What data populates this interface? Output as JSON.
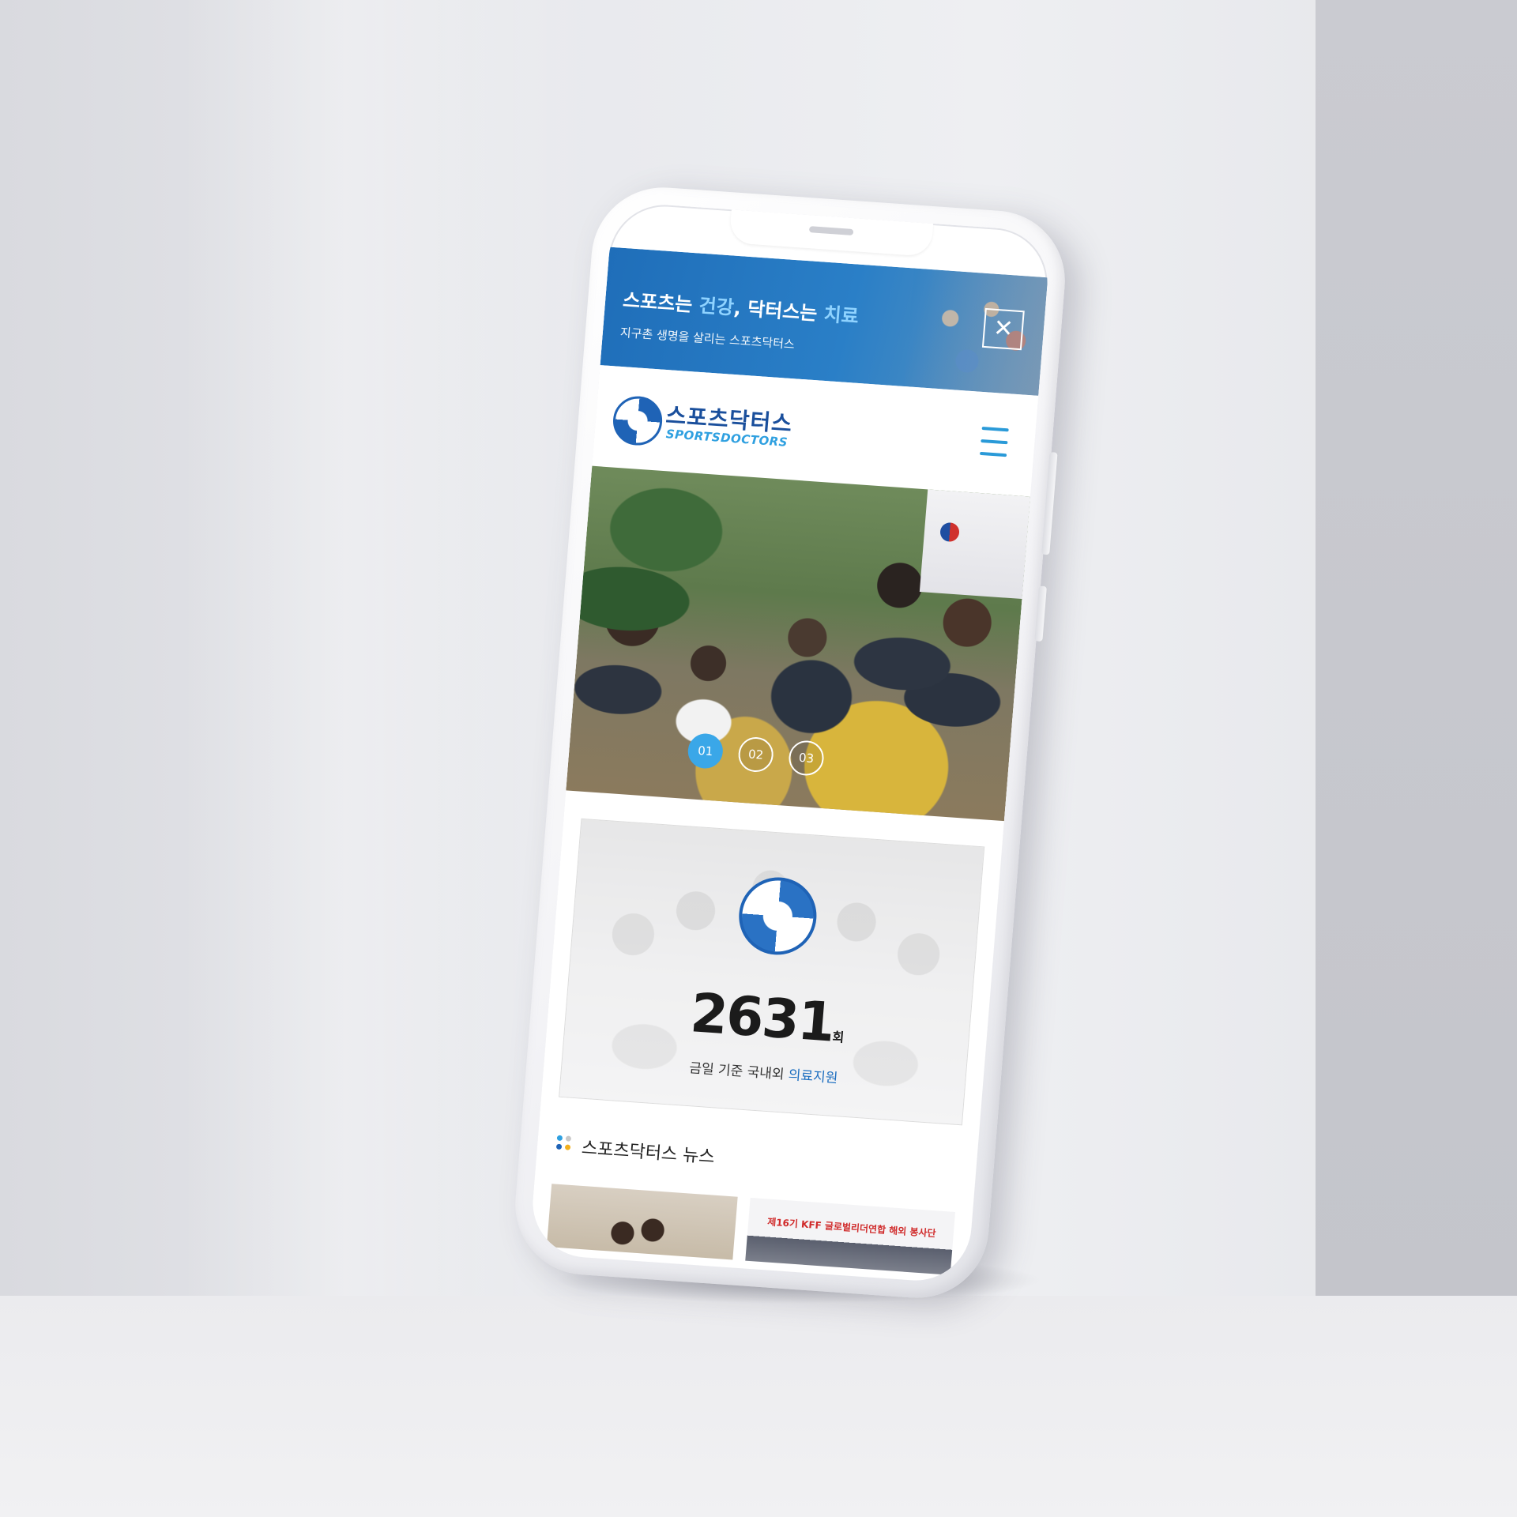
{
  "top_banner": {
    "title_part1": "스포츠는 ",
    "title_highlight1": "건강",
    "title_part2": ", 닥터스는 ",
    "title_highlight2": "치료",
    "subtitle": "지구촌 생명을 살리는 스포츠닥터스",
    "close_icon": "✕"
  },
  "header": {
    "logo_kr": "스포츠닥터스",
    "logo_en": "SPORTSDOCTORS",
    "menu_icon": "hamburger-icon"
  },
  "slider": {
    "pages": [
      "01",
      "02",
      "03"
    ],
    "active_index": 0
  },
  "stats": {
    "count": "2631",
    "unit": "회",
    "caption_part1": "금일 기준 국내외 ",
    "caption_highlight": "의료지원"
  },
  "news": {
    "title": "스포츠닥터스 뉴스",
    "thumb2_banner": "제16기 KFF 글로벌리더연합 해외 봉사단",
    "bullet_colors": [
      "#2fa0e0",
      "#c8c8c8",
      "#1f63b6",
      "#f2b01e"
    ]
  },
  "colors": {
    "brand_blue": "#1f6eb9",
    "accent_sky": "#3aa7e8",
    "highlight_blue": "#1e6fc0"
  }
}
